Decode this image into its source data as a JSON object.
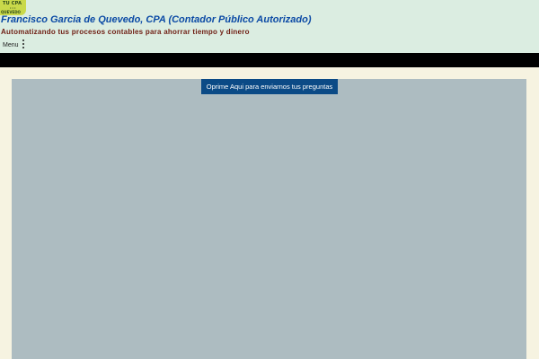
{
  "logo": {
    "top_text": "TU CPA",
    "bottom_text": "QUEVEDO"
  },
  "header": {
    "title": "Francisco Garcia de Quevedo, CPA (Contador Público Autorizado)",
    "tagline": "Automatizando tus procesos contables para ahorrar tiempo y dinero"
  },
  "menu": {
    "label": "Menu",
    "icon": "vertical-ellipsis-icon"
  },
  "content": {
    "cta_label": "Oprime Aqui para enviarnos tus preguntas"
  },
  "colors": {
    "header_bg": "#dbede1",
    "page_bg": "#f6f3e1",
    "title": "#0b4aa5",
    "tagline": "#6e1d12",
    "content_bg": "#adbcc1",
    "button_bg": "#0b4a86"
  }
}
